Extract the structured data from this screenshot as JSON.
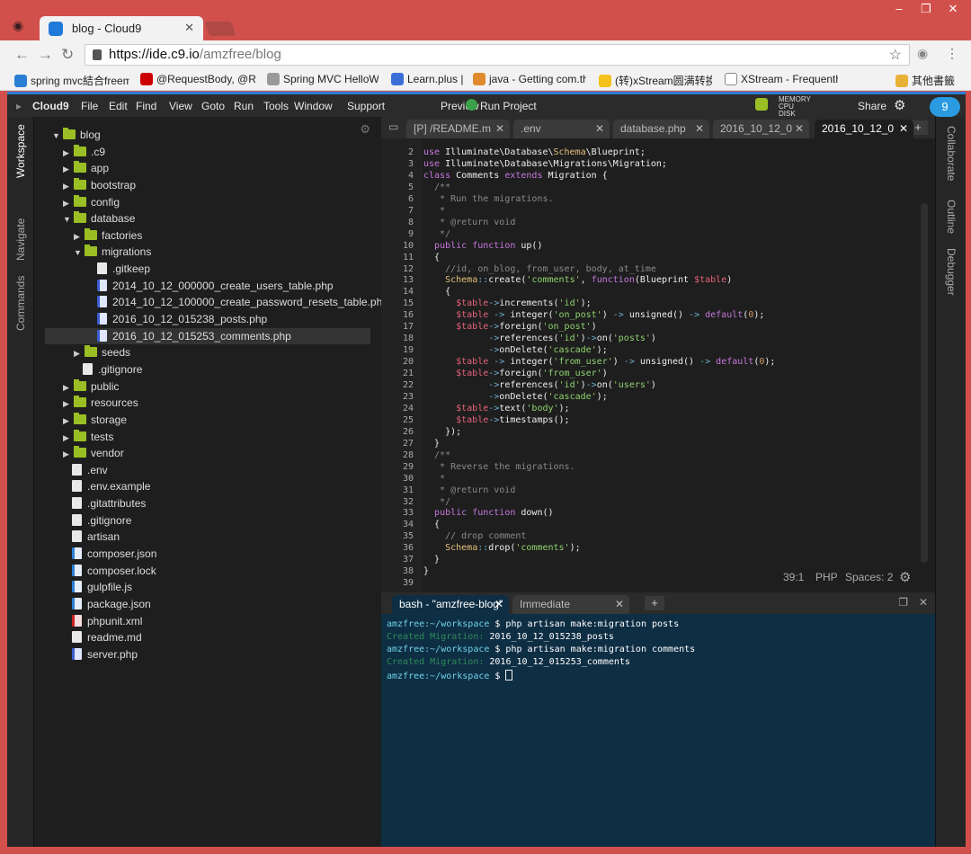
{
  "browser": {
    "tab_title": "blog - Cloud9",
    "url_host": "https://ide.c9.io",
    "url_path": "/amzfree/blog",
    "bookmarks": [
      {
        "label": "spring mvc結合freem",
        "color": "#2a7fd4"
      },
      {
        "label": "@RequestBody, @Re",
        "color": "#c00"
      },
      {
        "label": "Spring MVC HelloWo",
        "color": "#999"
      },
      {
        "label": "Learn.plus |",
        "color": "#3a6fd8"
      },
      {
        "label": "java - Getting com.th",
        "color": "#e0892d"
      },
      {
        "label": "(转)xStream圆满转换",
        "color": "#f3c21b"
      },
      {
        "label": "XStream - Frequenth",
        "color": "#ffffff"
      },
      {
        "label": "其他書籤",
        "color": "#e8b238"
      }
    ]
  },
  "menubar": {
    "brand": "Cloud9",
    "items": [
      "File",
      "Edit",
      "Find",
      "View",
      "Goto",
      "Run",
      "Tools",
      "Window",
      "Support"
    ],
    "preview": "Preview",
    "run_project": "Run Project",
    "mem": [
      "MEMORY",
      "CPU",
      "DISK"
    ],
    "share": "Share",
    "logo_num": "9"
  },
  "sidebar_left": [
    "Workspace",
    "Navigate",
    "Commands"
  ],
  "sidebar_right": [
    "Collaborate",
    "Outline",
    "Debugger"
  ],
  "tree": [
    {
      "label": "blog",
      "type": "folder",
      "level": 0,
      "open": true
    },
    {
      "label": ".c9",
      "type": "folder",
      "level": 1,
      "open": false
    },
    {
      "label": "app",
      "type": "folder",
      "level": 1,
      "open": false
    },
    {
      "label": "bootstrap",
      "type": "folder",
      "level": 1,
      "open": false
    },
    {
      "label": "config",
      "type": "folder",
      "level": 1,
      "open": false
    },
    {
      "label": "database",
      "type": "folder",
      "level": 1,
      "open": true
    },
    {
      "label": "factories",
      "type": "folder",
      "level": 2,
      "open": false
    },
    {
      "label": "migrations",
      "type": "folder",
      "level": 2,
      "open": true
    },
    {
      "label": ".gitkeep",
      "type": "file",
      "level": 3
    },
    {
      "label": "2014_10_12_000000_create_users_table.php",
      "type": "php",
      "level": 3
    },
    {
      "label": "2014_10_12_100000_create_password_resets_table.php",
      "type": "php",
      "level": 3
    },
    {
      "label": "2016_10_12_015238_posts.php",
      "type": "php",
      "level": 3
    },
    {
      "label": "2016_10_12_015253_comments.php",
      "type": "php",
      "level": 3,
      "selected": true
    },
    {
      "label": "seeds",
      "type": "folder",
      "level": 2,
      "open": false
    },
    {
      "label": ".gitignore",
      "type": "file",
      "level": 2
    },
    {
      "label": "public",
      "type": "folder",
      "level": 1,
      "open": false
    },
    {
      "label": "resources",
      "type": "folder",
      "level": 1,
      "open": false
    },
    {
      "label": "storage",
      "type": "folder",
      "level": 1,
      "open": false
    },
    {
      "label": "tests",
      "type": "folder",
      "level": 1,
      "open": false
    },
    {
      "label": "vendor",
      "type": "folder",
      "level": 1,
      "open": false
    },
    {
      "label": ".env",
      "type": "file",
      "level": 1
    },
    {
      "label": ".env.example",
      "type": "file",
      "level": 1
    },
    {
      "label": ".gitattributes",
      "type": "file",
      "level": 1
    },
    {
      "label": ".gitignore",
      "type": "file",
      "level": 1
    },
    {
      "label": "artisan",
      "type": "file",
      "level": 1
    },
    {
      "label": "composer.json",
      "type": "js",
      "level": 1
    },
    {
      "label": "composer.lock",
      "type": "js",
      "level": 1
    },
    {
      "label": "gulpfile.js",
      "type": "js",
      "level": 1
    },
    {
      "label": "package.json",
      "type": "js",
      "level": 1
    },
    {
      "label": "phpunit.xml",
      "type": "xml",
      "level": 1
    },
    {
      "label": "readme.md",
      "type": "file",
      "level": 1
    },
    {
      "label": "server.php",
      "type": "php",
      "level": 1
    }
  ],
  "editor_tabs": [
    {
      "label": "[P] /README.m"
    },
    {
      "label": ".env"
    },
    {
      "label": "database.php"
    },
    {
      "label": "2016_10_12_0"
    },
    {
      "label": "2016_10_12_0",
      "active": true
    }
  ],
  "code": [
    {
      "n": "2",
      "t": "use Illuminate\\Database\\Schema\\Blueprint;"
    },
    {
      "n": "3",
      "t": "use Illuminate\\Database\\Migrations\\Migration;"
    },
    {
      "n": "4",
      "t": "class Comments extends Migration {"
    },
    {
      "n": "5",
      "t": "  /**"
    },
    {
      "n": "6",
      "t": "   * Run the migrations."
    },
    {
      "n": "7",
      "t": "   *"
    },
    {
      "n": "8",
      "t": "   * @return void"
    },
    {
      "n": "9",
      "t": "   */"
    },
    {
      "n": "10",
      "t": "  public function up()"
    },
    {
      "n": "11",
      "t": "  {"
    },
    {
      "n": "12",
      "t": "    //id, on_blog, from_user, body, at_time"
    },
    {
      "n": "13",
      "t": "    Schema::create('comments', function(Blueprint $table)"
    },
    {
      "n": "14",
      "t": "    {"
    },
    {
      "n": "15",
      "t": "      $table->increments('id');"
    },
    {
      "n": "16",
      "t": "      $table -> integer('on_post') -> unsigned() -> default(0);"
    },
    {
      "n": "17",
      "t": "      $table->foreign('on_post')"
    },
    {
      "n": "18",
      "t": "            ->references('id')->on('posts')"
    },
    {
      "n": "19",
      "t": "            ->onDelete('cascade');"
    },
    {
      "n": "20",
      "t": "      $table -> integer('from_user') -> unsigned() -> default(0);"
    },
    {
      "n": "21",
      "t": "      $table->foreign('from_user')"
    },
    {
      "n": "22",
      "t": "            ->references('id')->on('users')"
    },
    {
      "n": "23",
      "t": "            ->onDelete('cascade');"
    },
    {
      "n": "24",
      "t": "      $table->text('body');"
    },
    {
      "n": "25",
      "t": "      $table->timestamps();"
    },
    {
      "n": "26",
      "t": "    });"
    },
    {
      "n": "27",
      "t": "  }"
    },
    {
      "n": "28",
      "t": "  /**"
    },
    {
      "n": "29",
      "t": "   * Reverse the migrations."
    },
    {
      "n": "30",
      "t": "   *"
    },
    {
      "n": "31",
      "t": "   * @return void"
    },
    {
      "n": "32",
      "t": "   */"
    },
    {
      "n": "33",
      "t": "  public function down()"
    },
    {
      "n": "34",
      "t": "  {"
    },
    {
      "n": "35",
      "t": "    // drop comment"
    },
    {
      "n": "36",
      "t": "    Schema::drop('comments');"
    },
    {
      "n": "37",
      "t": "  }"
    },
    {
      "n": "38",
      "t": "}"
    },
    {
      "n": "39",
      "t": ""
    }
  ],
  "status": {
    "pos": "39:1",
    "lang": "PHP",
    "spaces": "Spaces: 2"
  },
  "term_tabs": [
    {
      "label": "bash - \"amzfree-blog\"",
      "active": true
    },
    {
      "label": "Immediate"
    }
  ],
  "terminal": [
    {
      "prompt": "amzfree:~/workspace",
      "cmd": "$ php artisan make:migration posts"
    },
    {
      "created": "Created Migration:",
      "rest": " 2016_10_12_015238_posts"
    },
    {
      "prompt": "amzfree:~/workspace",
      "cmd": "$ php artisan make:migration comments"
    },
    {
      "created": "Created Migration:",
      "rest": " 2016_10_12_015253_comments"
    },
    {
      "prompt": "amzfree:~/workspace",
      "cmd": "$ ",
      "cursor": true
    }
  ]
}
